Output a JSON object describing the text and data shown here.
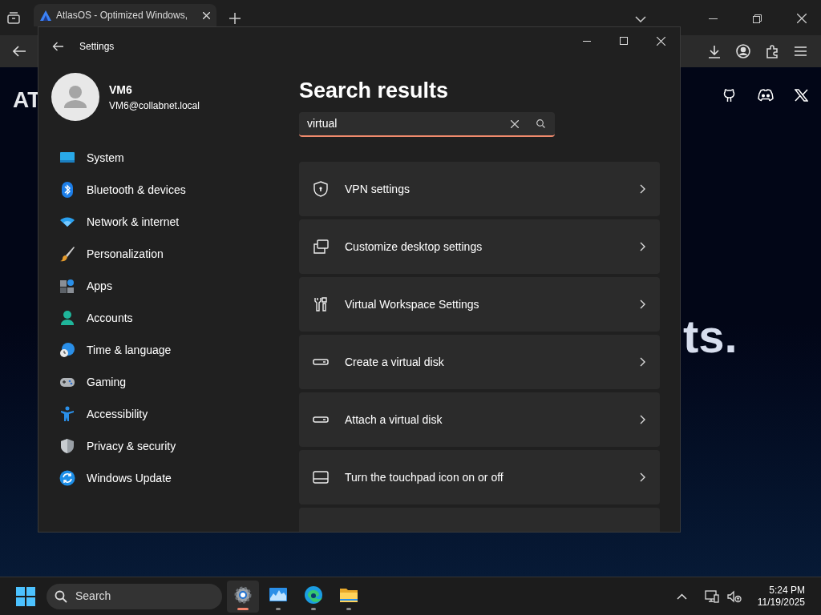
{
  "browser": {
    "tab": {
      "title": "AtlasOS - Optimized Windows,",
      "selected": true
    },
    "page_text_left": "AT",
    "page_text_right": "ts."
  },
  "window": {
    "title": "Settings"
  },
  "profile": {
    "name": "VM6",
    "email": "VM6@collabnet.local"
  },
  "sidebar": {
    "items": [
      {
        "label": "System"
      },
      {
        "label": "Bluetooth & devices"
      },
      {
        "label": "Network & internet"
      },
      {
        "label": "Personalization"
      },
      {
        "label": "Apps"
      },
      {
        "label": "Accounts"
      },
      {
        "label": "Time & language"
      },
      {
        "label": "Gaming"
      },
      {
        "label": "Accessibility"
      },
      {
        "label": "Privacy & security"
      },
      {
        "label": "Windows Update"
      }
    ]
  },
  "main": {
    "heading": "Search results",
    "search": {
      "value": "virtual"
    },
    "results": [
      {
        "label": "VPN settings"
      },
      {
        "label": "Customize desktop settings"
      },
      {
        "label": "Virtual Workspace Settings"
      },
      {
        "label": "Create a virtual disk"
      },
      {
        "label": "Attach a virtual disk"
      },
      {
        "label": "Turn the touchpad icon on or off"
      }
    ]
  },
  "taskbar": {
    "search_placeholder": "Search",
    "apps": [
      {
        "selected": true
      },
      {
        "selected": false
      },
      {
        "selected": false
      },
      {
        "selected": false
      }
    ],
    "time": "5:24 PM",
    "date": "11/19/2025"
  }
}
